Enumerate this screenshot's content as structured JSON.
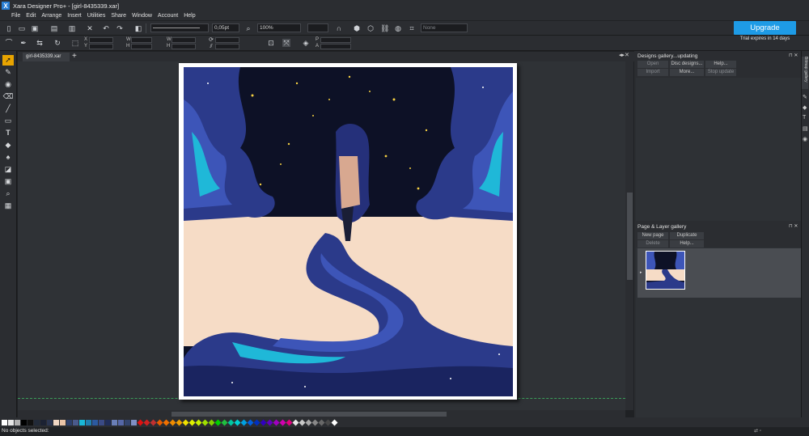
{
  "window": {
    "title": "Xara Designer Pro+ - [girl-8435339.xar]"
  },
  "menu": [
    "File",
    "Edit",
    "Arrange",
    "Insert",
    "Utilities",
    "Share",
    "Window",
    "Account",
    "Help"
  ],
  "toolbar": {
    "line_width": "0,05pt",
    "zoom": "100%",
    "none_label": "None",
    "coord_labels": [
      "X",
      "Y",
      "W",
      "H",
      "W",
      "H"
    ],
    "transp_labels": [
      "P",
      "A"
    ]
  },
  "upgrade": {
    "label": "Upgrade",
    "trial": "Trial expires in 14 days"
  },
  "document_tab": {
    "label": "girl-8435339.xar",
    "add": "+"
  },
  "designs_gallery": {
    "title": "Designs gallery...updating",
    "buttons": [
      "Open",
      "Disc designs...",
      "Help...",
      "Import",
      "More...",
      "Stop update"
    ]
  },
  "page_layer_gallery": {
    "title": "Page & Layer gallery",
    "buttons": [
      "New page",
      "Duplicate",
      "Delete",
      "Help..."
    ]
  },
  "side_tab": {
    "label": "Bitmap gallery"
  },
  "status": {
    "text": "No objects selected:"
  },
  "colors": {
    "accent": "#1e9be6",
    "active_tool": "#e8a400",
    "panel_bg": "#2b2d31",
    "canvas_bg": "#2f3236"
  },
  "palette": [
    "#ffffff",
    "#e6e6e6",
    "#b0b0b0",
    "#000000",
    "#111111",
    "#222a38",
    "#1c2233",
    "#2b3550",
    "#f1d7c4",
    "#e9c4a8",
    "#2d3f6b",
    "#4a5a8c",
    "#19b8d8",
    "#1f7fb0",
    "#2c5aa0",
    "#3a4a86",
    "#202d5a",
    "#6a7fb8",
    "#5567a8",
    "#33446e",
    "#7f8fc4",
    "#e01010",
    "#d02020",
    "#c03030",
    "#e65c00",
    "#f07000",
    "#f08c00",
    "#f0a000",
    "#f0e000",
    "#e0f000",
    "#c8f000",
    "#a0e000",
    "#80d000",
    "#00d000",
    "#20c040",
    "#00c8a0",
    "#00d0d0",
    "#00a0e0",
    "#0060e0",
    "#0030c0",
    "#3000c0",
    "#6000c0",
    "#a000c0",
    "#d000b0",
    "#e00080",
    "#e8e8e8",
    "#c8c8c8",
    "#a8a8a8",
    "#888888",
    "#686868",
    "#484848",
    "#ffffff"
  ],
  "tools": [
    "selector",
    "contour",
    "camera",
    "eraser",
    "pen",
    "rectangle",
    "text",
    "fill",
    "paint",
    "shadow",
    "zoom-push",
    "magnify",
    "grid"
  ]
}
